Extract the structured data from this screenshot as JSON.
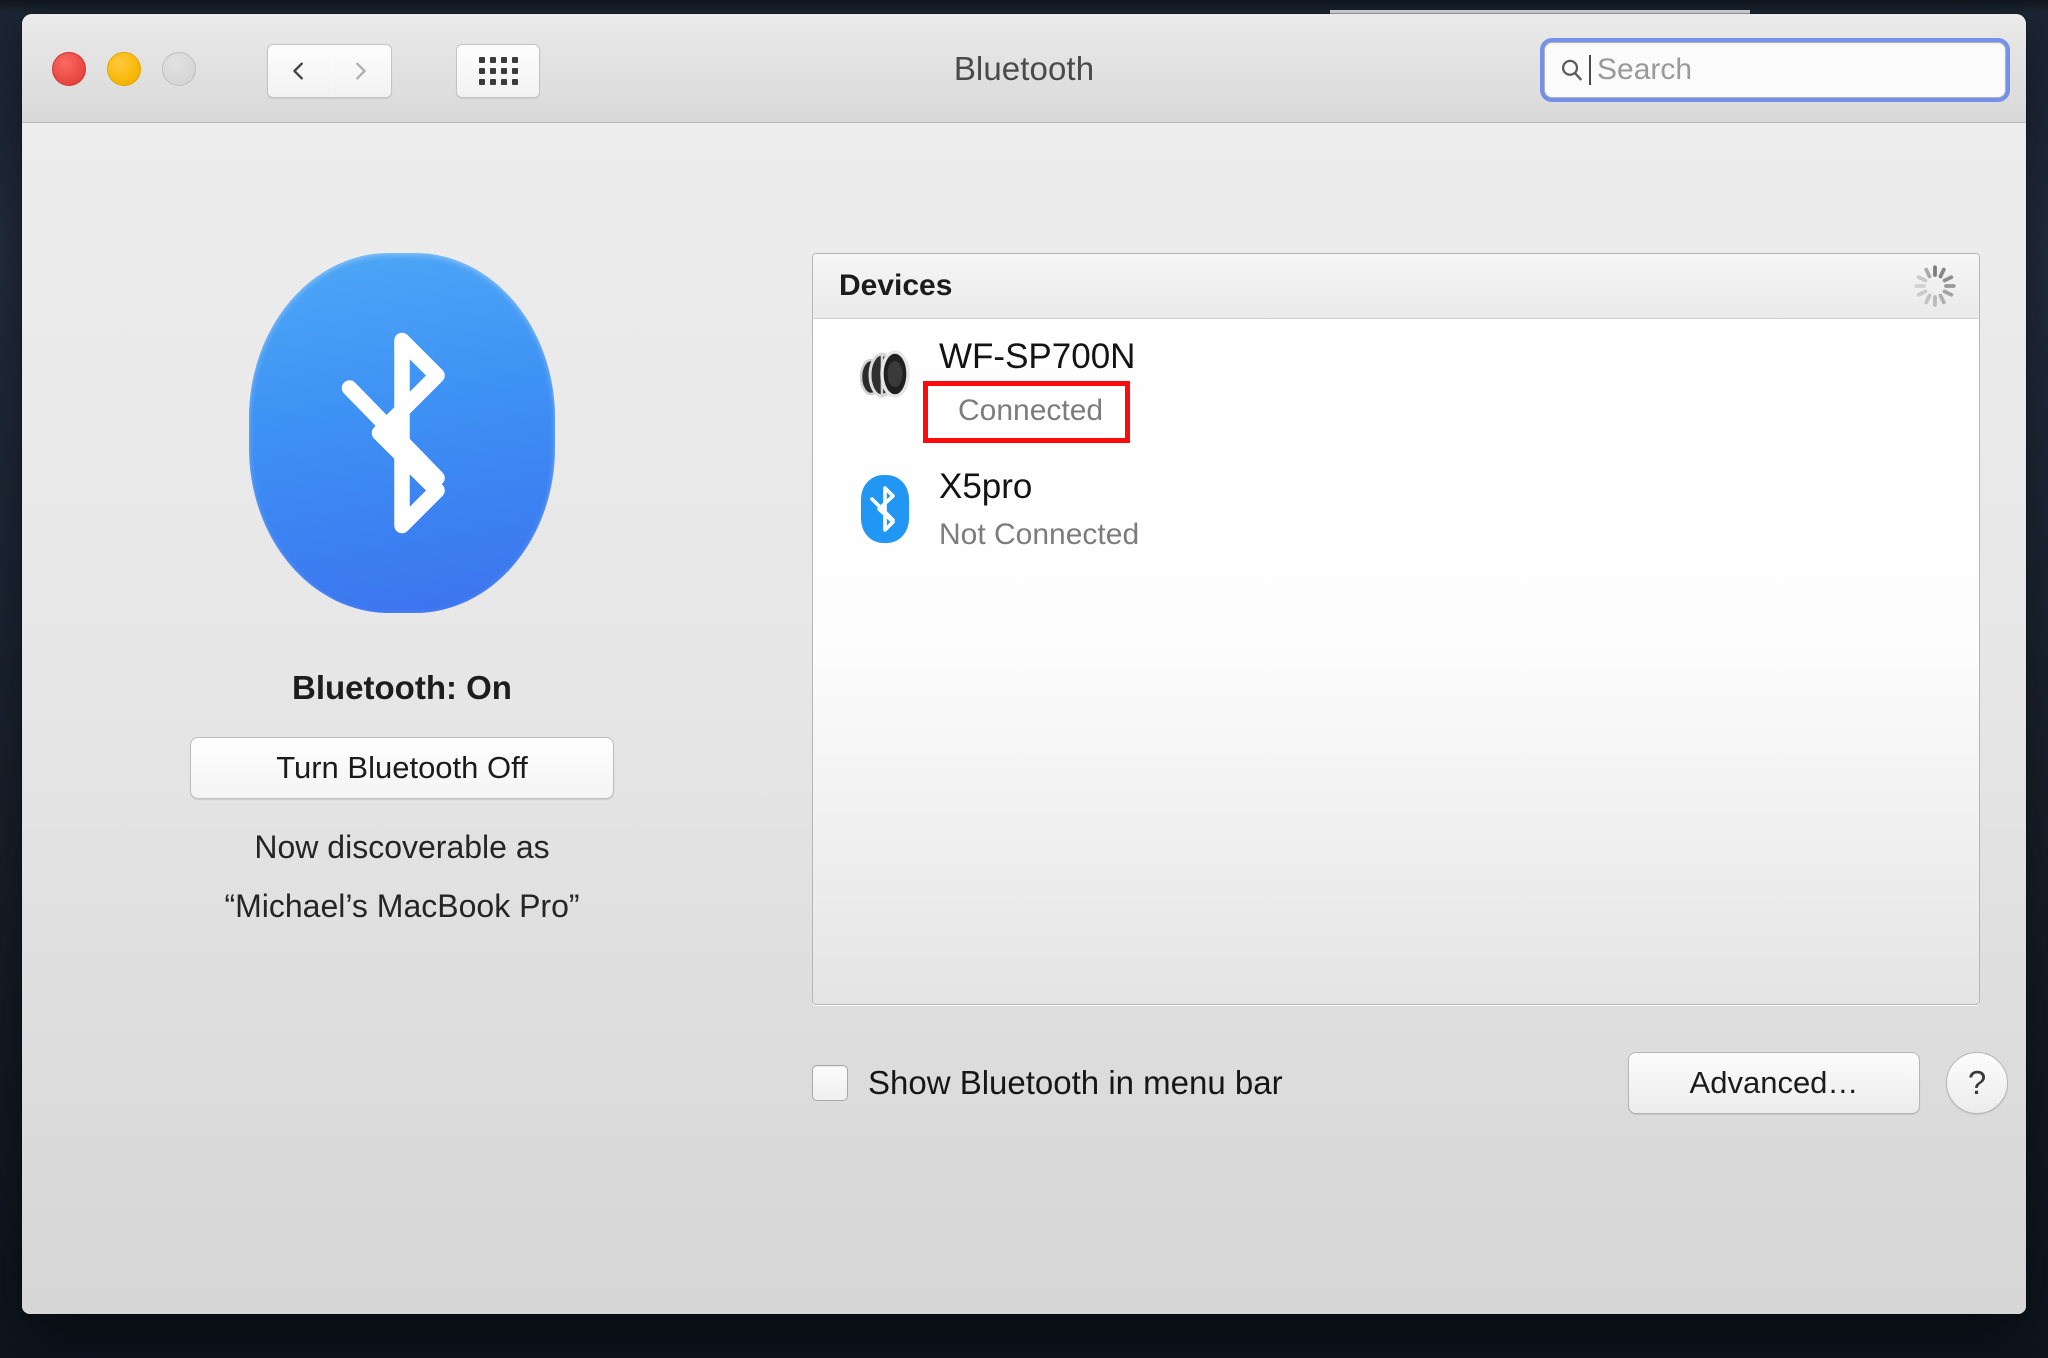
{
  "window": {
    "title": "Bluetooth",
    "traffic_lights": {
      "close": "close-button",
      "minimize": "minimize-button",
      "zoom": "zoom-button"
    },
    "colors": {
      "close": "#e8453f",
      "minimize": "#f7b500",
      "zoom": "#d6d6d6",
      "accent_blue": "#3b72ef",
      "focus_ring": "#5f83eb",
      "annotation_red": "#fb0b0b"
    }
  },
  "toolbar": {
    "back_icon": "chevron-left-icon",
    "forward_icon": "chevron-right-icon",
    "show_all_icon": "grid-icon"
  },
  "search": {
    "icon": "search-icon",
    "value": "",
    "placeholder": "Search",
    "focused": true
  },
  "left_pane": {
    "logo_icon": "bluetooth-logo-icon",
    "status": "Bluetooth: On",
    "toggle_button": "Turn Bluetooth Off",
    "discoverable_line1": "Now discoverable as",
    "discoverable_line2": "“Michael’s MacBook Pro”"
  },
  "devices_panel": {
    "header": "Devices",
    "spinner_icon": "scanning-spinner-icon",
    "items": [
      {
        "name": "WF-SP700N",
        "status": "Connected",
        "icon": "speaker-icon",
        "highlighted": true
      },
      {
        "name": "X5pro",
        "status": "Not Connected",
        "icon": "bluetooth-device-icon",
        "highlighted": false
      }
    ]
  },
  "footer": {
    "checkbox_label": "Show Bluetooth in menu bar",
    "checkbox_checked": false,
    "advanced_button": "Advanced…",
    "help_button": "?"
  }
}
